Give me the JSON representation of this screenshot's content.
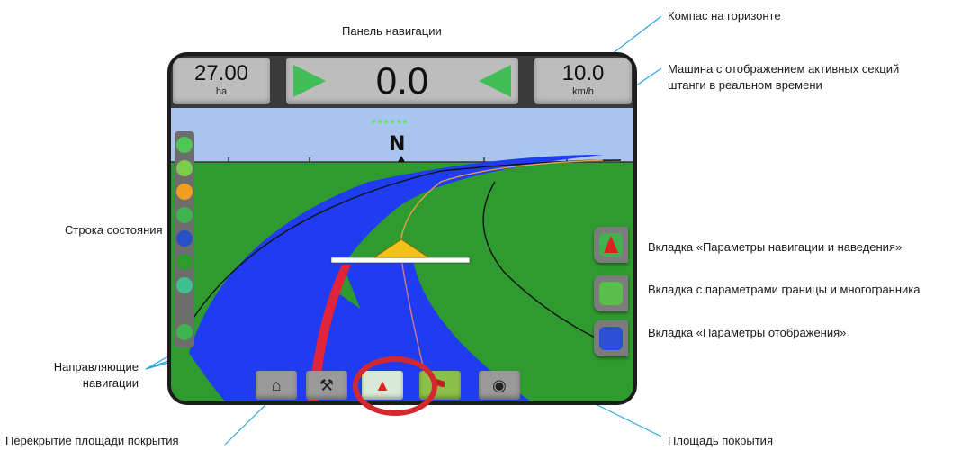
{
  "callouts": {
    "nav_panel": "Панель навигации",
    "horizon_compass": "Компас на горизонте",
    "vehicle": "Машина с отображением активных секций штанги в реальном времени",
    "status_bar": "Строка состояния",
    "nav_tab": "Вкладка «Параметры навигации и наведения»",
    "boundary_tab": "Вкладка с параметрами границы и многогранника",
    "display_tab": "Вкладка «Параметры отображения»",
    "guide_lines": "Направляющие навигации",
    "overlap": "Перекрытие площади покрытия",
    "coverage": "Площадь покрытия"
  },
  "screen": {
    "area": {
      "value": "27.00",
      "unit": "ha"
    },
    "speed": {
      "value": "10.0",
      "unit": "km/h"
    },
    "cross_track": "0.0",
    "compass_heading": "N",
    "satellite_dots": "●●●●●●"
  },
  "icons": {
    "status": [
      "flag-icon",
      "guidance-icon",
      "boundary-icon",
      "gnss-icon",
      "tilt-icon",
      "boom-icon",
      "droplet-icon",
      "steering-icon"
    ],
    "right_tabs": [
      "nav-arrow-icon",
      "boundary-chat-icon",
      "display-chat-icon"
    ],
    "bottom": [
      "home-icon",
      "tools-icon",
      "nav-icon",
      "field-flag-icon",
      "camera-icon"
    ]
  },
  "colors": {
    "sky": "#a9c4ee",
    "field": "#2f9a2f",
    "coverage": "#1f3cf0",
    "overlap": "#e2243a",
    "highlight": "#d4282f",
    "leader": "#29a9e0"
  }
}
